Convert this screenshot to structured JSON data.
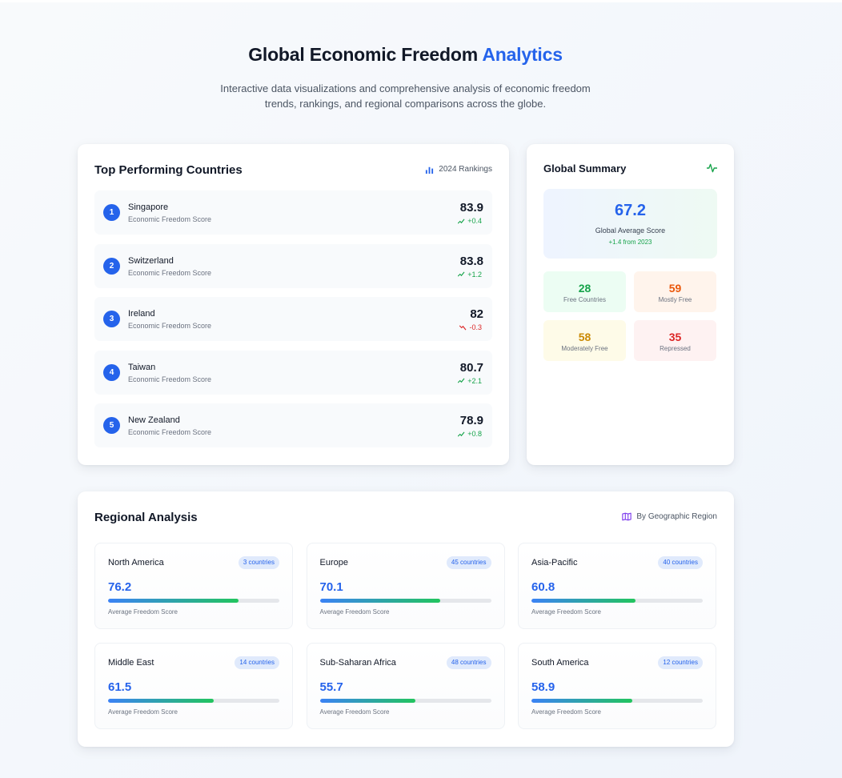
{
  "header": {
    "title_main": "Global Economic Freedom",
    "title_accent": "Analytics",
    "subtitle": "Interactive data visualizations and comprehensive analysis of economic freedom trends, rankings, and regional comparisons across the globe."
  },
  "top_countries": {
    "title": "Top Performing Countries",
    "tag": "2024 Rankings",
    "score_label": "Economic Freedom Score",
    "items": [
      {
        "rank": "1",
        "name": "Singapore",
        "score": "83.9",
        "change": "+0.4",
        "direction": "up"
      },
      {
        "rank": "2",
        "name": "Switzerland",
        "score": "83.8",
        "change": "+1.2",
        "direction": "up"
      },
      {
        "rank": "3",
        "name": "Ireland",
        "score": "82",
        "change": "-0.3",
        "direction": "down"
      },
      {
        "rank": "4",
        "name": "Taiwan",
        "score": "80.7",
        "change": "+2.1",
        "direction": "up"
      },
      {
        "rank": "5",
        "name": "New Zealand",
        "score": "78.9",
        "change": "+0.8",
        "direction": "up"
      }
    ]
  },
  "summary": {
    "title": "Global Summary",
    "avg_score": "67.2",
    "avg_label": "Global Average Score",
    "avg_note": "+1.4 from 2023",
    "stats": [
      {
        "value": "28",
        "label": "Free Countries",
        "color": "#16a34a",
        "bg": "#ecfdf3"
      },
      {
        "value": "59",
        "label": "Mostly Free",
        "color": "#ea580c",
        "bg": "#fff4ec"
      },
      {
        "value": "58",
        "label": "Moderately Free",
        "color": "#ca8a04",
        "bg": "#fefbe8"
      },
      {
        "value": "35",
        "label": "Repressed",
        "color": "#dc2626",
        "bg": "#fef2f2"
      }
    ]
  },
  "regional": {
    "title": "Regional Analysis",
    "tag": "By Geographic Region",
    "avg_label": "Average Freedom Score",
    "items": [
      {
        "name": "North America",
        "count": "3 countries",
        "score": "76.2",
        "fill_pct": 76.2
      },
      {
        "name": "Europe",
        "count": "45 countries",
        "score": "70.1",
        "fill_pct": 70.1
      },
      {
        "name": "Asia-Pacific",
        "count": "40 countries",
        "score": "60.8",
        "fill_pct": 60.8
      },
      {
        "name": "Middle East",
        "count": "14 countries",
        "score": "61.5",
        "fill_pct": 61.5
      },
      {
        "name": "Sub-Saharan Africa",
        "count": "48 countries",
        "score": "55.7",
        "fill_pct": 55.7
      },
      {
        "name": "South America",
        "count": "12 countries",
        "score": "58.9",
        "fill_pct": 58.9
      }
    ]
  },
  "colors": {
    "accent": "#2563eb",
    "positive": "#16a34a",
    "negative": "#dc2626"
  }
}
